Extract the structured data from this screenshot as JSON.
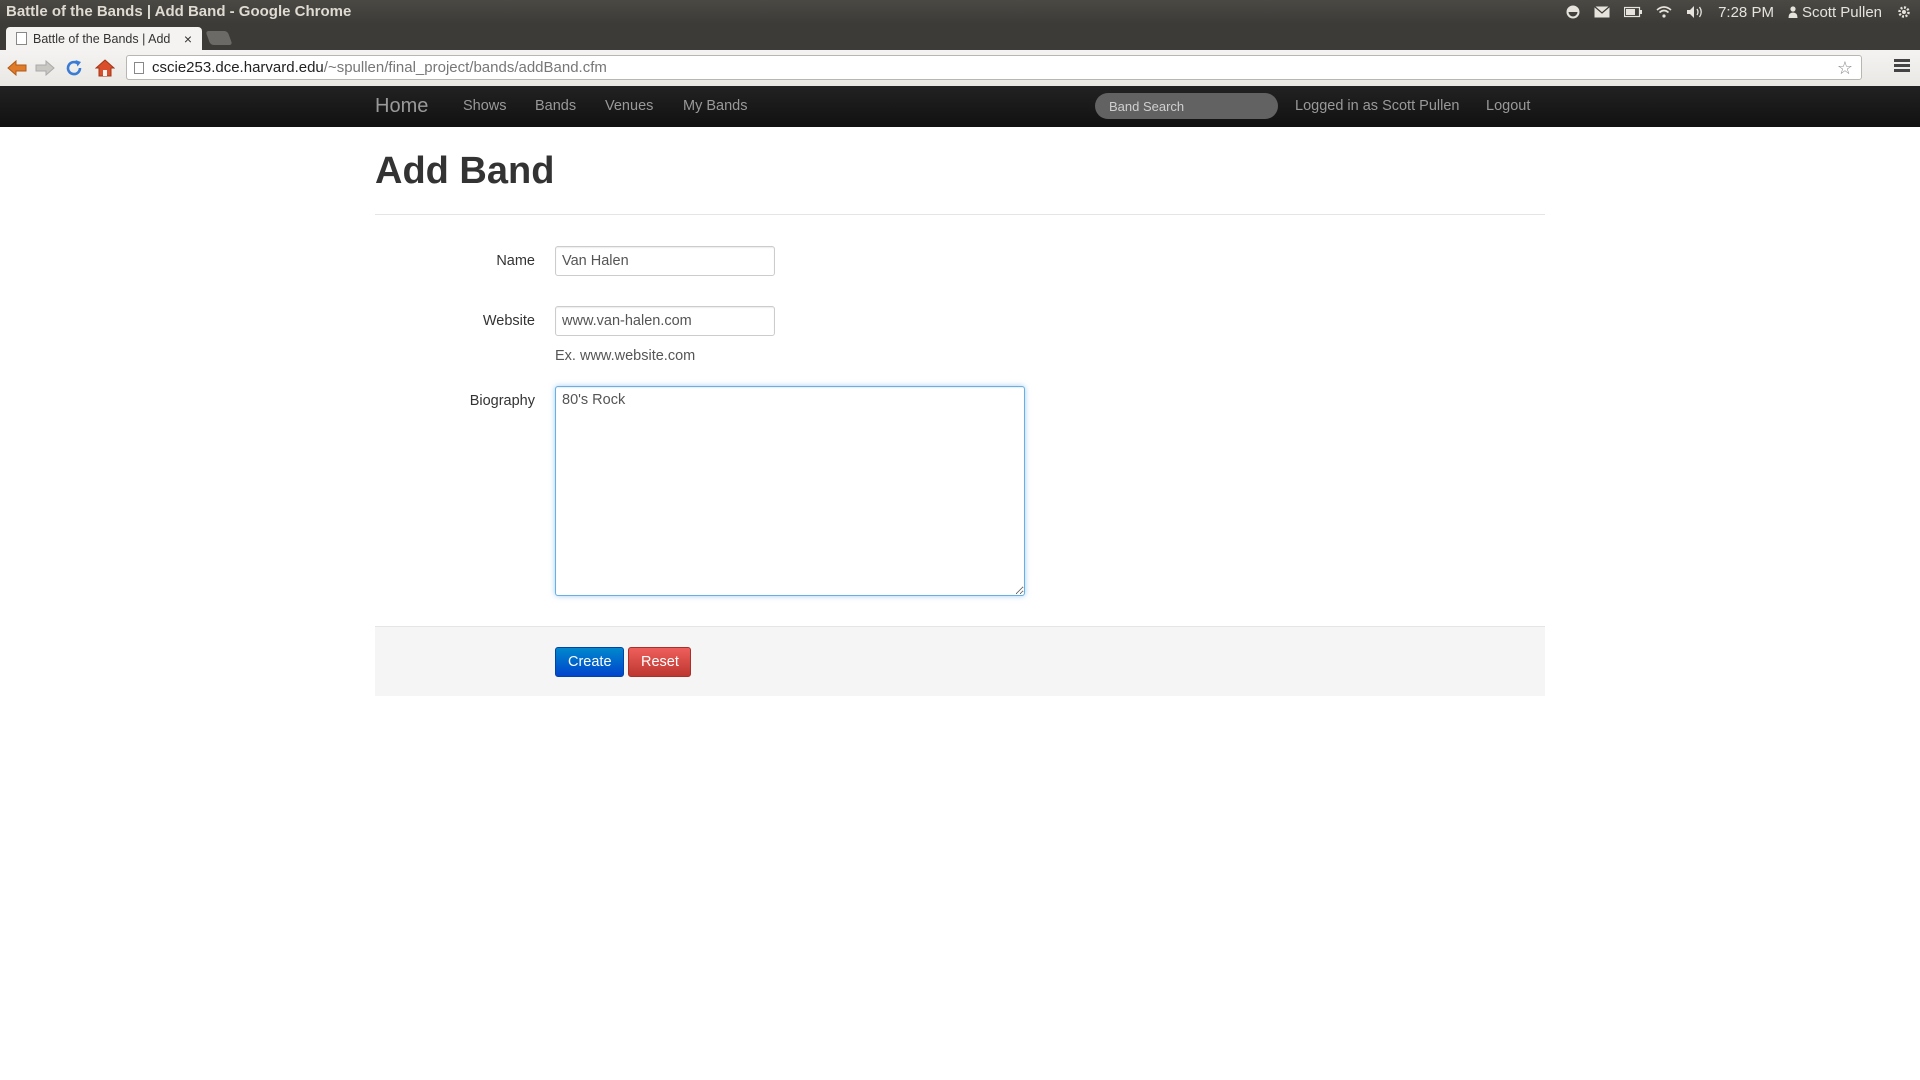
{
  "os": {
    "window_title": "Battle of the Bands | Add Band - Google Chrome",
    "time": "7:28 PM",
    "user": "Scott Pullen"
  },
  "browser": {
    "tab_title": "Battle of the Bands | Add",
    "tab_close": "×",
    "url_host": "cscie253.dce.harvard.edu",
    "url_path": "/~spullen/final_project/bands/addBand.cfm",
    "star": "☆"
  },
  "navbar": {
    "brand": "Home",
    "links": [
      "Shows",
      "Bands",
      "Venues",
      "My Bands"
    ],
    "search_placeholder": "Band Search",
    "logged_in": "Logged in as Scott Pullen",
    "logout": "Logout"
  },
  "page": {
    "title": "Add Band"
  },
  "form": {
    "name_label": "Name",
    "name_value": "Van Halen",
    "website_label": "Website",
    "website_value": "www.van-halen.com",
    "website_help": "Ex. www.website.com",
    "biography_label": "Biography",
    "biography_value": "80's Rock",
    "create_label": "Create",
    "reset_label": "Reset"
  },
  "colors": {
    "navbar_bg": "#1b1b1b",
    "primary": "#0055cc",
    "danger": "#c9302c",
    "focus": "#66afe9"
  }
}
